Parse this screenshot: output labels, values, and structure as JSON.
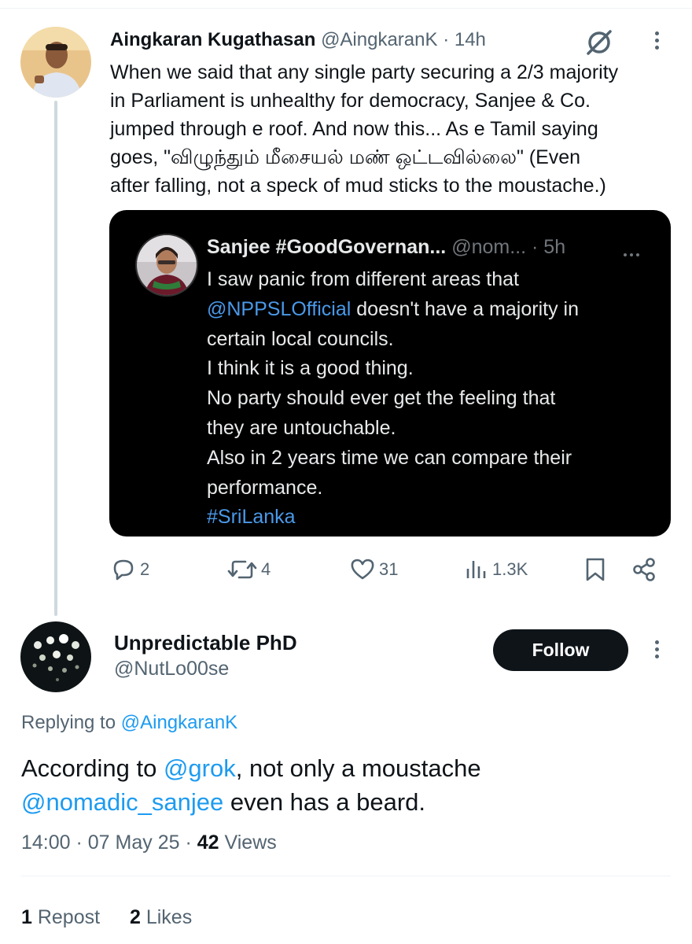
{
  "original_tweet": {
    "author_name": "Aingkaran Kugathasan",
    "handle": "@AingkaranK",
    "separator": "·",
    "time": "14h",
    "text_lines": [
      "When we said that any single party securing a 2/3 majority",
      "in Parliament is unhealthy for democracy, Sanjee & Co.",
      "jumped through e roof. And now this... As e Tamil saying",
      "goes, \"விழுந்தும் மீசையல் மண் ஒட்டவில்லை\" (Even",
      "after falling, not a speck of mud sticks to the moustache.)"
    ],
    "quoted": {
      "author_name": "Sanjee #GoodGovernan...",
      "handle": "@nom...",
      "separator": "·",
      "time": "5h",
      "line1": "I saw panic from different areas that",
      "mention": "@NPPSLOfficial",
      "line2_rest": " doesn't have a majority in",
      "line3": "certain local councils.",
      "line4": "I think it is a good thing.",
      "line5": "No party should ever get the feeling that",
      "line6": "they are untouchable.",
      "line7": "Also in 2 years time we can compare their",
      "line8": "performance.",
      "hashtag": "#SriLanka"
    },
    "actions": {
      "replies": "2",
      "reposts": "4",
      "likes": "31",
      "views": "1.3K"
    }
  },
  "reply": {
    "author_name": "Unpredictable PhD",
    "handle": "@NutLo00se",
    "follow_label": "Follow",
    "replying_prefix": "Replying to ",
    "replying_to": "@AingkaranK",
    "text_prefix": "According to ",
    "mention_grok": "@grok",
    "text_mid": ", not only a moustache",
    "mention_sanjee": "@nomadic_sanjee",
    "text_end": " even has a beard.",
    "time": "14:00",
    "sep1": " · ",
    "date": "07 May 25",
    "sep2": " · ",
    "views_count": "42",
    "views_label": " Views",
    "reposts_count": "1",
    "reposts_label": " Repost",
    "likes_count": "2",
    "likes_label": " Likes"
  },
  "colors": {
    "link": "#1d9bf0",
    "muted": "#536471",
    "text": "#0f1419",
    "quote_bg": "#000000",
    "follow_bg": "#0f1419"
  },
  "icons": [
    "grok-icon",
    "more-vertical-icon",
    "more-horizontal-icon",
    "reply-icon",
    "repost-icon",
    "like-icon",
    "views-icon",
    "bookmark-icon",
    "share-icon"
  ]
}
